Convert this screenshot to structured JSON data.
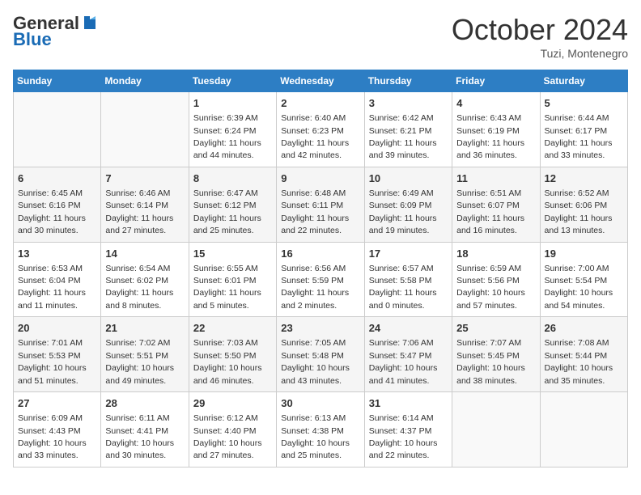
{
  "header": {
    "logo_general": "General",
    "logo_blue": "Blue",
    "month_title": "October 2024",
    "location": "Tuzi, Montenegro"
  },
  "weekdays": [
    "Sunday",
    "Monday",
    "Tuesday",
    "Wednesday",
    "Thursday",
    "Friday",
    "Saturday"
  ],
  "rows": [
    [
      {
        "day": "",
        "detail": ""
      },
      {
        "day": "",
        "detail": ""
      },
      {
        "day": "1",
        "detail": "Sunrise: 6:39 AM\nSunset: 6:24 PM\nDaylight: 11 hours and 44 minutes."
      },
      {
        "day": "2",
        "detail": "Sunrise: 6:40 AM\nSunset: 6:23 PM\nDaylight: 11 hours and 42 minutes."
      },
      {
        "day": "3",
        "detail": "Sunrise: 6:42 AM\nSunset: 6:21 PM\nDaylight: 11 hours and 39 minutes."
      },
      {
        "day": "4",
        "detail": "Sunrise: 6:43 AM\nSunset: 6:19 PM\nDaylight: 11 hours and 36 minutes."
      },
      {
        "day": "5",
        "detail": "Sunrise: 6:44 AM\nSunset: 6:17 PM\nDaylight: 11 hours and 33 minutes."
      }
    ],
    [
      {
        "day": "6",
        "detail": "Sunrise: 6:45 AM\nSunset: 6:16 PM\nDaylight: 11 hours and 30 minutes."
      },
      {
        "day": "7",
        "detail": "Sunrise: 6:46 AM\nSunset: 6:14 PM\nDaylight: 11 hours and 27 minutes."
      },
      {
        "day": "8",
        "detail": "Sunrise: 6:47 AM\nSunset: 6:12 PM\nDaylight: 11 hours and 25 minutes."
      },
      {
        "day": "9",
        "detail": "Sunrise: 6:48 AM\nSunset: 6:11 PM\nDaylight: 11 hours and 22 minutes."
      },
      {
        "day": "10",
        "detail": "Sunrise: 6:49 AM\nSunset: 6:09 PM\nDaylight: 11 hours and 19 minutes."
      },
      {
        "day": "11",
        "detail": "Sunrise: 6:51 AM\nSunset: 6:07 PM\nDaylight: 11 hours and 16 minutes."
      },
      {
        "day": "12",
        "detail": "Sunrise: 6:52 AM\nSunset: 6:06 PM\nDaylight: 11 hours and 13 minutes."
      }
    ],
    [
      {
        "day": "13",
        "detail": "Sunrise: 6:53 AM\nSunset: 6:04 PM\nDaylight: 11 hours and 11 minutes."
      },
      {
        "day": "14",
        "detail": "Sunrise: 6:54 AM\nSunset: 6:02 PM\nDaylight: 11 hours and 8 minutes."
      },
      {
        "day": "15",
        "detail": "Sunrise: 6:55 AM\nSunset: 6:01 PM\nDaylight: 11 hours and 5 minutes."
      },
      {
        "day": "16",
        "detail": "Sunrise: 6:56 AM\nSunset: 5:59 PM\nDaylight: 11 hours and 2 minutes."
      },
      {
        "day": "17",
        "detail": "Sunrise: 6:57 AM\nSunset: 5:58 PM\nDaylight: 11 hours and 0 minutes."
      },
      {
        "day": "18",
        "detail": "Sunrise: 6:59 AM\nSunset: 5:56 PM\nDaylight: 10 hours and 57 minutes."
      },
      {
        "day": "19",
        "detail": "Sunrise: 7:00 AM\nSunset: 5:54 PM\nDaylight: 10 hours and 54 minutes."
      }
    ],
    [
      {
        "day": "20",
        "detail": "Sunrise: 7:01 AM\nSunset: 5:53 PM\nDaylight: 10 hours and 51 minutes."
      },
      {
        "day": "21",
        "detail": "Sunrise: 7:02 AM\nSunset: 5:51 PM\nDaylight: 10 hours and 49 minutes."
      },
      {
        "day": "22",
        "detail": "Sunrise: 7:03 AM\nSunset: 5:50 PM\nDaylight: 10 hours and 46 minutes."
      },
      {
        "day": "23",
        "detail": "Sunrise: 7:05 AM\nSunset: 5:48 PM\nDaylight: 10 hours and 43 minutes."
      },
      {
        "day": "24",
        "detail": "Sunrise: 7:06 AM\nSunset: 5:47 PM\nDaylight: 10 hours and 41 minutes."
      },
      {
        "day": "25",
        "detail": "Sunrise: 7:07 AM\nSunset: 5:45 PM\nDaylight: 10 hours and 38 minutes."
      },
      {
        "day": "26",
        "detail": "Sunrise: 7:08 AM\nSunset: 5:44 PM\nDaylight: 10 hours and 35 minutes."
      }
    ],
    [
      {
        "day": "27",
        "detail": "Sunrise: 6:09 AM\nSunset: 4:43 PM\nDaylight: 10 hours and 33 minutes."
      },
      {
        "day": "28",
        "detail": "Sunrise: 6:11 AM\nSunset: 4:41 PM\nDaylight: 10 hours and 30 minutes."
      },
      {
        "day": "29",
        "detail": "Sunrise: 6:12 AM\nSunset: 4:40 PM\nDaylight: 10 hours and 27 minutes."
      },
      {
        "day": "30",
        "detail": "Sunrise: 6:13 AM\nSunset: 4:38 PM\nDaylight: 10 hours and 25 minutes."
      },
      {
        "day": "31",
        "detail": "Sunrise: 6:14 AM\nSunset: 4:37 PM\nDaylight: 10 hours and 22 minutes."
      },
      {
        "day": "",
        "detail": ""
      },
      {
        "day": "",
        "detail": ""
      }
    ]
  ]
}
